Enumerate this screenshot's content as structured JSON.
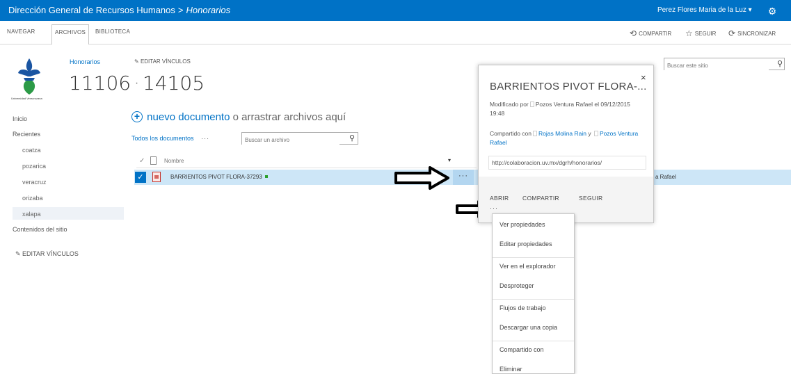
{
  "suite_bar": {
    "site": "Dirección General de Recursos Humanos",
    "separator": ">",
    "library": "Honorarios",
    "user": "Perez Flores Maria de la Luz ▾",
    "gear_icon": "gear-icon",
    "color": "#0072c6"
  },
  "ribbon": {
    "tabs": [
      "NAVEGAR",
      "ARCHIVOS",
      "BIBLIOTECA"
    ],
    "active_tab": "ARCHIVOS",
    "actions": [
      "COMPARTIR",
      "SEGUIR",
      "SINCRONIZAR"
    ]
  },
  "header": {
    "breadcrumb_library": "Honorarios",
    "edit_links": "EDITAR VÍNCULOS",
    "title_part1": "11106",
    "title_dot": "·",
    "title_part2": "14105",
    "logo_caption": "Universidad Veracruzana"
  },
  "search_site": {
    "placeholder": "Buscar este sitio"
  },
  "quick_launch": {
    "items": [
      "Inicio",
      "Recientes",
      "coatza",
      "pozarica",
      "veracruz",
      "orizaba",
      "xalapa",
      "Contenidos del sitio"
    ],
    "edit_links": "EDITAR VÍNCULOS",
    "selected": "xalapa"
  },
  "main": {
    "new_doc_link": "nuevo documento",
    "new_doc_rest": "o arrastrar archivos aquí",
    "view_all": "Todos los documentos",
    "view_more": "···",
    "search_file_placeholder": "Buscar un archivo",
    "column_name": "Nombre",
    "sort_indicator": "▾"
  },
  "rows": [
    {
      "name": "BARRIENTOS PIVOT FLORA-37293",
      "ellipsis": "···",
      "modified_by_fragment": "a Rafael",
      "selected": true
    }
  ],
  "callout": {
    "title": "BARRIENTOS PIVOT FLORA-...",
    "close": "×",
    "modified_prefix": "Modificado por",
    "modified_by": "Pozos Ventura Rafael",
    "modified_on": "el 09/12/2015 19:48",
    "shared_prefix": "Compartido con",
    "shared_user1": "Rojas Molina Rain",
    "shared_and": "y",
    "shared_user2": "Pozos Ventura Rafael",
    "url": "http://colaboracion.uv.mx/dgrh/honorarios/",
    "actions": [
      "ABRIR",
      "COMPARTIR",
      "SEGUIR"
    ],
    "more": "···"
  },
  "context_menu": {
    "items": [
      "Ver propiedades",
      "Editar propiedades",
      "Ver en el explorador",
      "Desproteger",
      "Flujos de trabajo",
      "Descargar una copia",
      "Compartido con",
      "Eliminar"
    ]
  }
}
